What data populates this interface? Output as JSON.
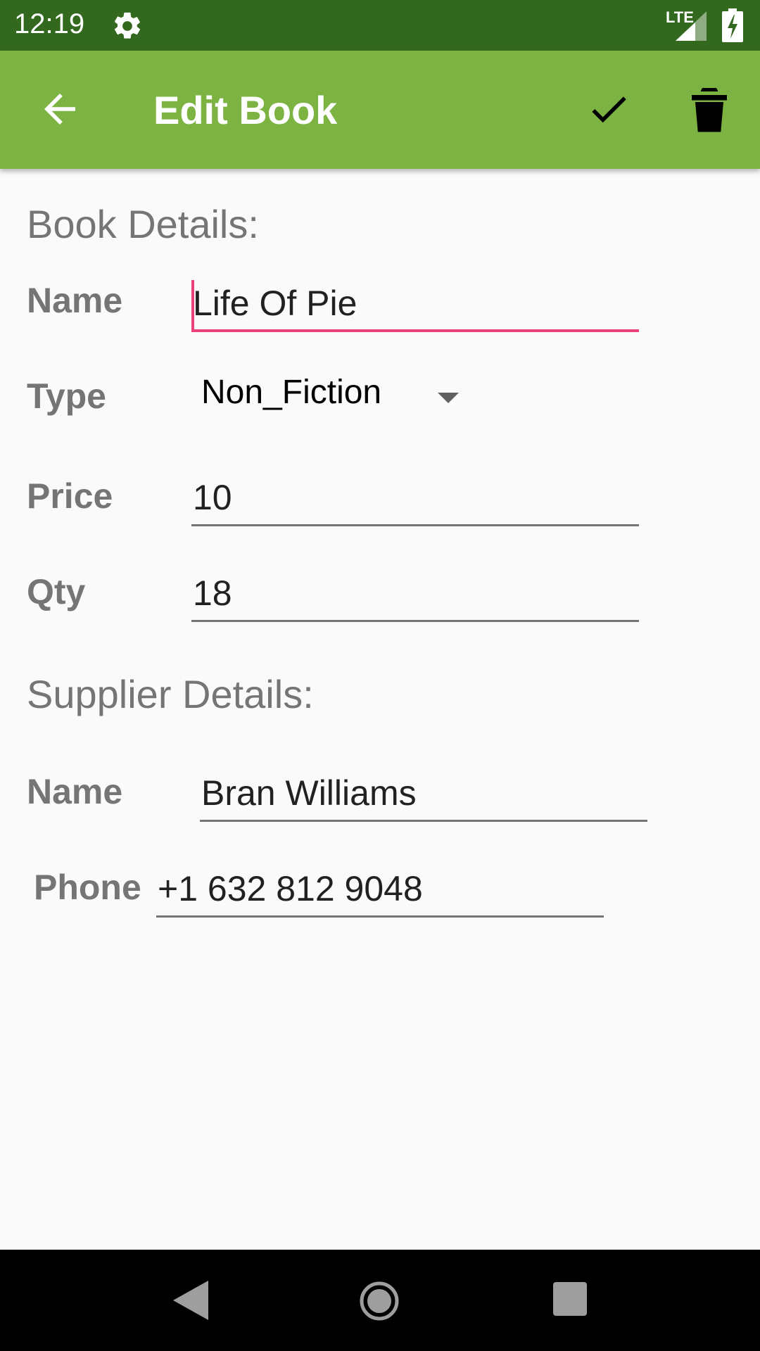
{
  "status_bar": {
    "time": "12:19",
    "network": "LTE",
    "icons": [
      "settings-gear-icon",
      "cell-signal-icon",
      "battery-charging-icon"
    ]
  },
  "app_bar": {
    "title": "Edit Book",
    "back_icon": "arrow-back-icon",
    "save_icon": "check-icon",
    "delete_icon": "trash-icon",
    "color": "#7cb342"
  },
  "book_details": {
    "heading": "Book Details:",
    "name_label": "Name",
    "name_value": "Life Of Pie",
    "type_label": "Type",
    "type_value": "Non_Fiction",
    "price_label": "Price",
    "price_value": "10",
    "qty_label": "Qty",
    "qty_value": "18"
  },
  "supplier_details": {
    "heading": "Supplier Details:",
    "name_label": "Name",
    "name_value": "Bran Williams",
    "phone_label": "Phone",
    "phone_value": "+1 632 812 9048"
  },
  "nav_bar": {
    "icons": [
      "nav-back-icon",
      "nav-home-icon",
      "nav-recents-icon"
    ]
  },
  "colors": {
    "status_bar": "#33691e",
    "accent": "#ec407a",
    "label": "#757575"
  }
}
